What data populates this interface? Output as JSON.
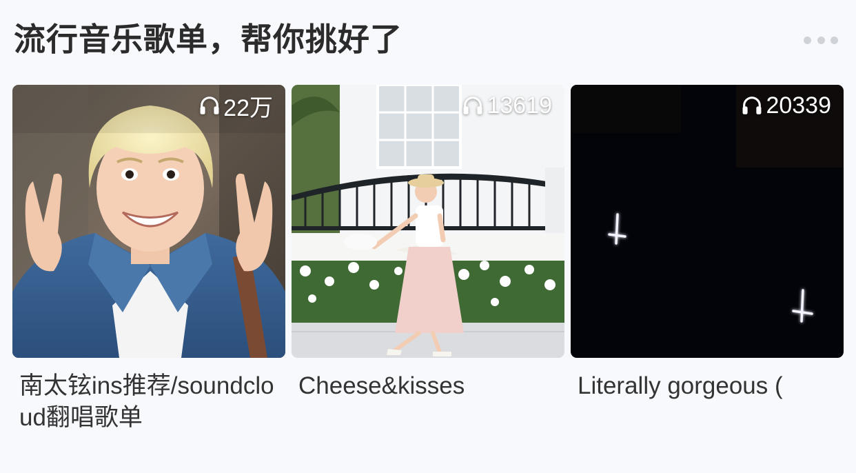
{
  "section": {
    "title": "流行音乐歌单，帮你挑好了",
    "more_icon": "more-dots-icon"
  },
  "playlists": [
    {
      "title": "南太铉ins推荐/soundcloud翻唱歌单",
      "play_count": "22万",
      "icon": "headphone-icon",
      "cover": "blonde person making peace signs, denim jacket"
    },
    {
      "title": "Cheese&kisses",
      "play_count": "13619",
      "icon": "headphone-icon",
      "cover": "woman in pink skirt walking past white fence and roses"
    },
    {
      "title": "Literally gorgeous (",
      "play_count": "20339",
      "icon": "headphone-icon",
      "cover": "dark image with two glowing inverted crosses"
    }
  ],
  "colors": {
    "background": "#f8f9fc",
    "title_text": "#2b2b2b",
    "card_text": "#333333",
    "more_dots": "#cfd2d7",
    "count_text": "#ffffff"
  }
}
